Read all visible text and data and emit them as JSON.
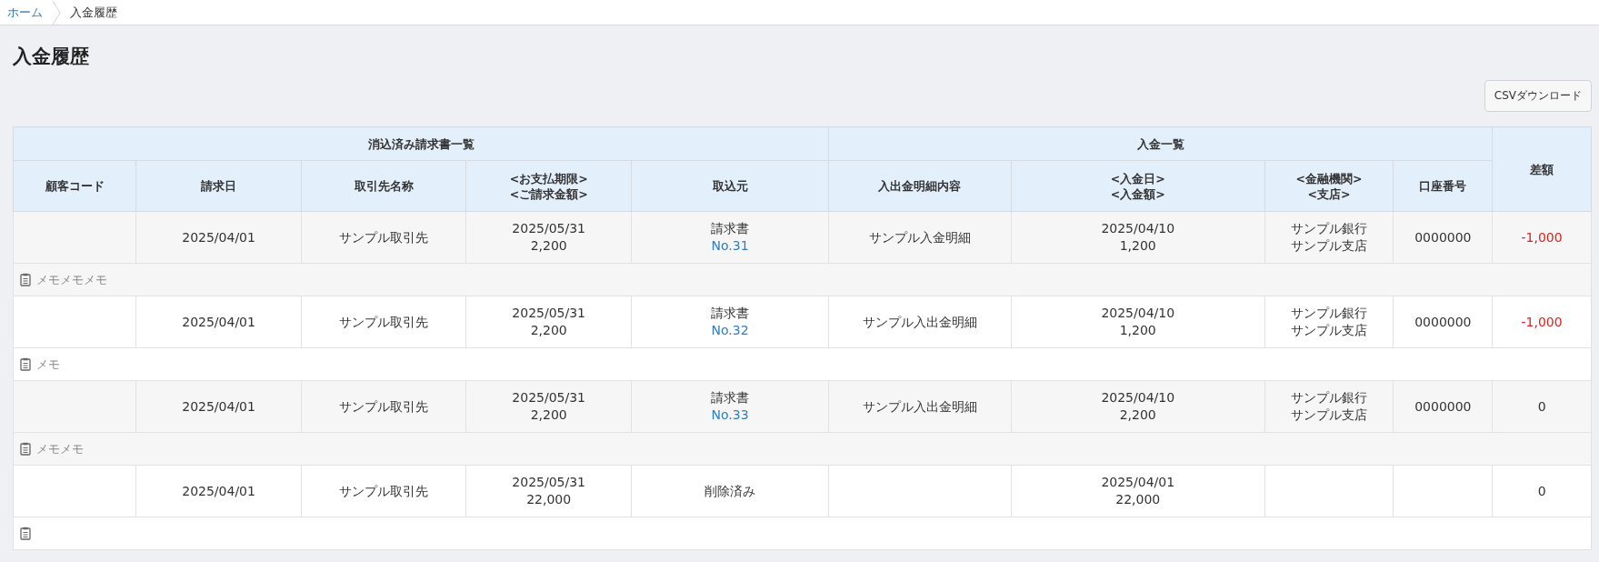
{
  "breadcrumb": [
    {
      "label": "ホーム",
      "link": true
    },
    {
      "label": "入金履歴",
      "link": false
    }
  ],
  "title": "入金履歴",
  "csv_button": "CSVダウンロード",
  "table": {
    "groups": [
      {
        "label": "消込済み請求書一覧"
      },
      {
        "label": "入金一覧"
      }
    ],
    "difference_header": "差額",
    "columns": [
      [
        "顧客コード"
      ],
      [
        "請求日"
      ],
      [
        "取引先名称"
      ],
      [
        "<お支払期限>",
        "<ご請求金額>"
      ],
      [
        "取込元"
      ],
      [
        "入出金明細内容"
      ],
      [
        "<入金日>",
        "<入金額>"
      ],
      [
        "<金融機関>",
        "<支店>"
      ],
      [
        "口座番号"
      ]
    ],
    "rows": [
      {
        "customer_code": "",
        "invoice_date": "2025/04/01",
        "partner": "サンプル取引先",
        "due_date": "2025/05/31",
        "invoice_amount": "2,200",
        "source": "請求書",
        "source_link": "No.31",
        "statement": "サンプル入金明細",
        "deposit_date": "2025/04/10",
        "deposit_amount": "1,200",
        "bank": "サンプル銀行",
        "branch": "サンプル支店",
        "account": "0000000",
        "difference": "-1,000",
        "negative": true,
        "memo": "メモメモメモ"
      },
      {
        "customer_code": "",
        "invoice_date": "2025/04/01",
        "partner": "サンプル取引先",
        "due_date": "2025/05/31",
        "invoice_amount": "2,200",
        "source": "請求書",
        "source_link": "No.32",
        "statement": "サンプル入出金明細",
        "deposit_date": "2025/04/10",
        "deposit_amount": "1,200",
        "bank": "サンプル銀行",
        "branch": "サンプル支店",
        "account": "0000000",
        "difference": "-1,000",
        "negative": true,
        "memo": "メモ"
      },
      {
        "customer_code": "",
        "invoice_date": "2025/04/01",
        "partner": "サンプル取引先",
        "due_date": "2025/05/31",
        "invoice_amount": "2,200",
        "source": "請求書",
        "source_link": "No.33",
        "statement": "サンプル入出金明細",
        "deposit_date": "2025/04/10",
        "deposit_amount": "2,200",
        "bank": "サンプル銀行",
        "branch": "サンプル支店",
        "account": "0000000",
        "difference": "0",
        "negative": false,
        "memo": "メモメモ"
      },
      {
        "customer_code": "",
        "invoice_date": "2025/04/01",
        "partner": "サンプル取引先",
        "due_date": "2025/05/31",
        "invoice_amount": "22,000",
        "source": "削除済み",
        "source_link": "",
        "statement": "",
        "deposit_date": "2025/04/01",
        "deposit_amount": "22,000",
        "bank": "",
        "branch": "",
        "account": "",
        "difference": "0",
        "negative": false,
        "memo": ""
      }
    ]
  }
}
